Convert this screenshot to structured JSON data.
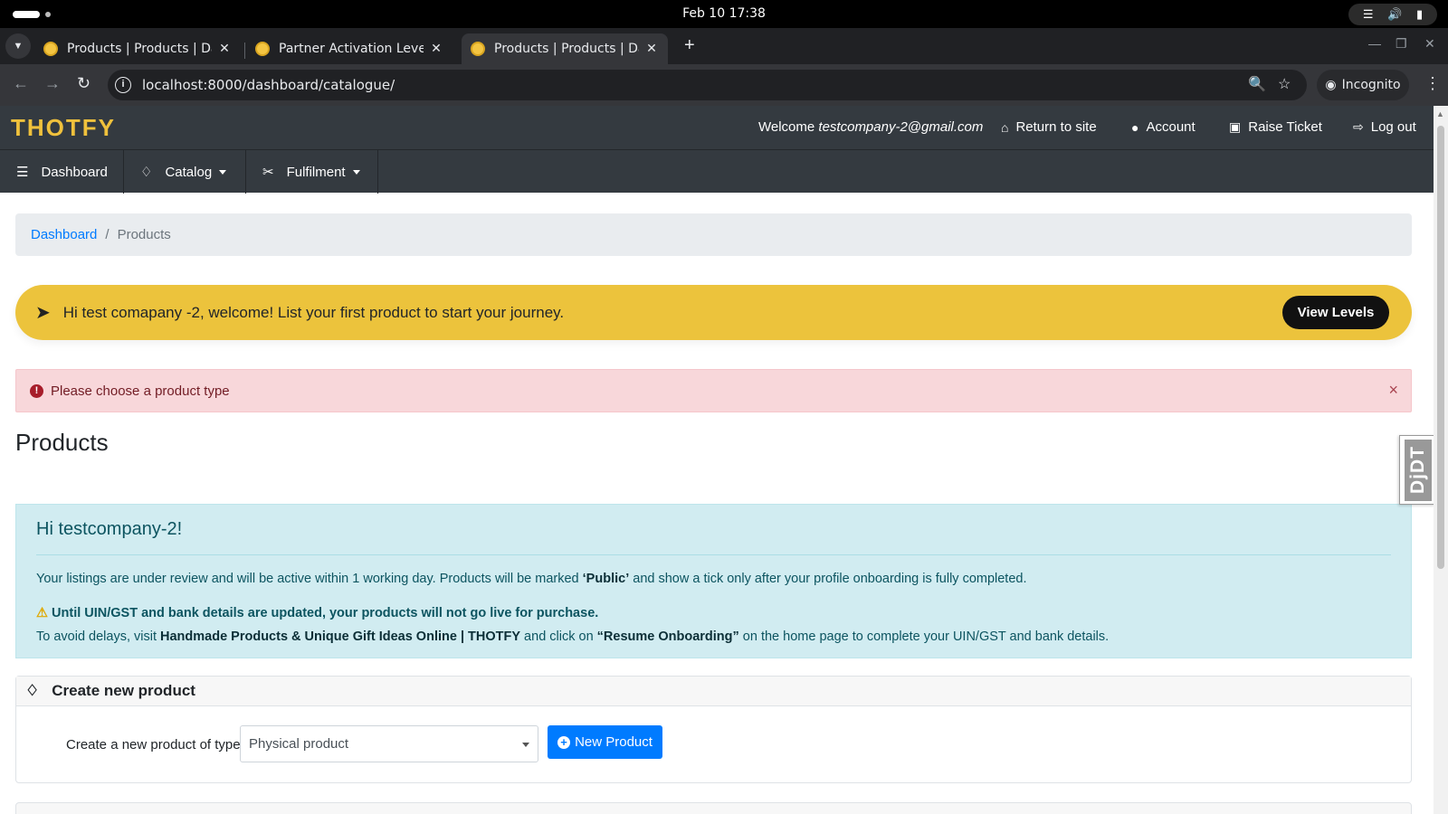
{
  "os": {
    "clock": "Feb 10  17:38"
  },
  "browser": {
    "tabs": [
      {
        "title": "Products | Products | Dashboard"
      },
      {
        "title": "Partner Activation Levels"
      },
      {
        "title": "Products | Products | Dashboard"
      }
    ],
    "url": "localhost:8000/dashboard/catalogue/",
    "incognito_label": "Incognito"
  },
  "header": {
    "logo": "THOTFY",
    "welcome_prefix": "Welcome",
    "welcome_email": "testcompany-2@gmail.com",
    "links": [
      "Return to site",
      "Account",
      "Raise Ticket",
      "Log out"
    ]
  },
  "nav": {
    "items": [
      {
        "label": "Dashboard"
      },
      {
        "label": "Catalog"
      },
      {
        "label": "Fulfilment"
      }
    ]
  },
  "breadcrumb": {
    "home": "Dashboard",
    "separator": "/",
    "current": "Products"
  },
  "banner": {
    "message": "Hi test comapany -2, welcome! List your first product to start your journey.",
    "button": "View Levels"
  },
  "error_alert": {
    "message": "Please choose a product type",
    "close": "×"
  },
  "page_title": "Products",
  "djdt": "DjDT",
  "info": {
    "heading": "Hi testcompany-2!",
    "p1_a": "Your listings are under review and will be active within 1 working day. Products will be marked ",
    "p1_b": "‘Public’",
    "p1_c": " and show a tick only after your profile onboarding is fully completed.",
    "p2": "Until UIN/GST and bank details are updated, your products will not go live for purchase.",
    "p3_a": "To avoid delays, visit ",
    "p3_b": "Handmade Products & Unique Gift Ideas Online | THOTFY",
    "p3_c": " and click on ",
    "p3_d": "“Resume Onboarding”",
    "p3_e": " on the home page to complete your UIN/GST and bank details."
  },
  "create_card": {
    "title": "Create new product",
    "label": "Create a new product of type:",
    "select_value": "Physical product",
    "button": "New Product"
  },
  "colors": {
    "accent_yellow": "#ecc33c",
    "primary": "#007bff",
    "header_bg": "#343a40"
  }
}
